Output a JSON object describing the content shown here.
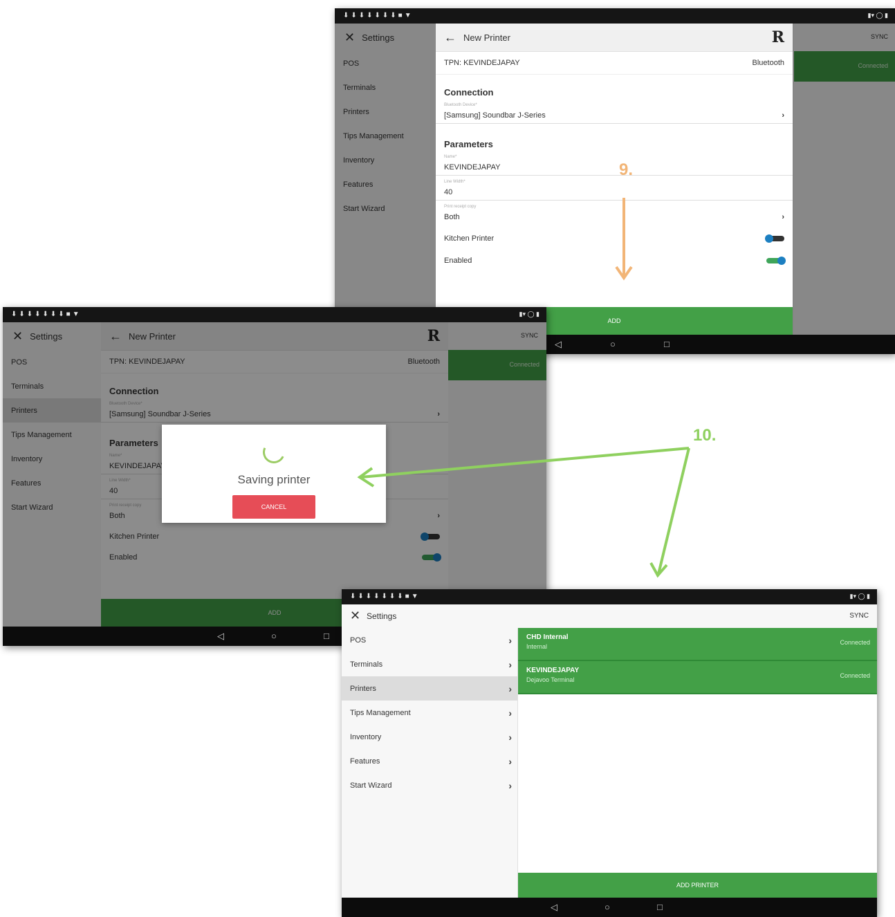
{
  "steps": {
    "nine": "9.",
    "ten": "10."
  },
  "colors": {
    "accent_green": "#43a047",
    "step9": "#f2b577",
    "step10": "#8fd05f",
    "cancel_red": "#e64d57"
  },
  "settings": {
    "close_icon": "close-icon",
    "title": "Settings",
    "sync": "SYNC",
    "menu": [
      "POS",
      "Terminals",
      "Printers",
      "Tips Management",
      "Inventory",
      "Features",
      "Start Wizard"
    ]
  },
  "new_printer": {
    "title": "New Printer",
    "back_icon": "arrow-left-icon",
    "tpn_label": "TPN: KEVINDEJAPAY",
    "connection_type": "Bluetooth",
    "connection_section": "Connection",
    "bluetooth_device_label": "Bluetooth Device*",
    "bluetooth_device_value": "[Samsung] Soundbar J-Series",
    "parameters_section": "Parameters",
    "name_label": "Name*",
    "name_value": "KEVINDEJAPAY",
    "line_width_label": "Line Width*",
    "line_width_value": "40",
    "print_mode_label": "Print receipt copy",
    "print_mode_value": "Both",
    "kitchen_printer_label": "Kitchen Printer",
    "kitchen_printer_on": false,
    "enabled_label": "Enabled",
    "enabled_on": true,
    "add_button": "ADD"
  },
  "background_right": {
    "top_label": "SYNC",
    "status": "Connected"
  },
  "modal": {
    "text": "Saving printer",
    "cancel": "CANCEL"
  },
  "printers": {
    "list": [
      {
        "name": "CHD Internal",
        "type": "Internal",
        "status": "Connected"
      },
      {
        "name": "KEVINDEJAPAY",
        "type": "Dejavoo Terminal",
        "status": "Connected"
      }
    ],
    "add_button": "ADD PRINTER"
  }
}
